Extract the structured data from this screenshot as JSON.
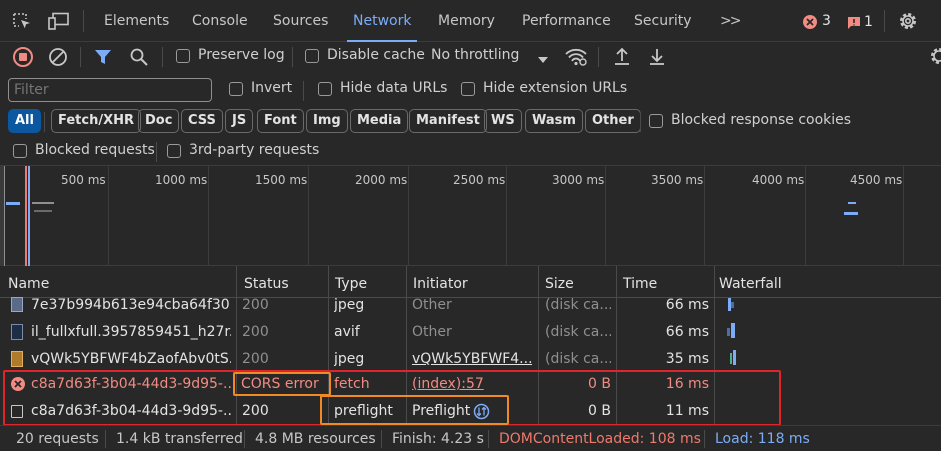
{
  "tabs": [
    {
      "label": "Elements"
    },
    {
      "label": "Console"
    },
    {
      "label": "Sources"
    },
    {
      "label": "Network"
    },
    {
      "label": "Memory"
    },
    {
      "label": "Performance"
    },
    {
      "label": "Security"
    }
  ],
  "more_tabs": ">>",
  "error_count": "3",
  "issue_count": "1",
  "toolbar": {
    "preserve_log": "Preserve log",
    "disable_cache": "Disable cache",
    "throttling": "No throttling"
  },
  "filter": {
    "placeholder": "Filter",
    "invert": "Invert",
    "hide_data_urls": "Hide data URLs",
    "hide_extension_urls": "Hide extension URLs"
  },
  "type_filters": [
    "All",
    "Fetch/XHR",
    "Doc",
    "CSS",
    "JS",
    "Font",
    "Img",
    "Media",
    "Manifest",
    "WS",
    "Wasm",
    "Other"
  ],
  "blocked_response_cookies": "Blocked response cookies",
  "blocked_requests": "Blocked requests",
  "third_party_requests": "3rd-party requests",
  "overview_ticks": [
    "500 ms",
    "1000 ms",
    "1500 ms",
    "2000 ms",
    "2500 ms",
    "3000 ms",
    "3500 ms",
    "4000 ms",
    "4500 ms"
  ],
  "columns": {
    "name": "Name",
    "status": "Status",
    "type": "Type",
    "initiator": "Initiator",
    "size": "Size",
    "time": "Time",
    "waterfall": "Waterfall"
  },
  "rows": [
    {
      "name": "7e37b994b613e94cba64f30...",
      "status": "200",
      "type": "jpeg",
      "initiator": "Other",
      "size": "(disk ca...",
      "time": "66 ms"
    },
    {
      "name": "il_fullxfull.3957859451_h27r.j...",
      "status": "200",
      "type": "avif",
      "initiator": "Other",
      "size": "(disk ca...",
      "time": "66 ms"
    },
    {
      "name": "vQWk5YBFWF4bZaofAbv0tS...",
      "status": "200",
      "type": "jpeg",
      "initiator": "vQWk5YBFWF4...",
      "size": "(disk ca...",
      "time": "35 ms"
    },
    {
      "name": "c8a7d63f-3b04-44d3-9d95-...",
      "status": "CORS error",
      "type": "fetch",
      "initiator": "(index):57",
      "size": "0 B",
      "time": "16 ms"
    },
    {
      "name": "c8a7d63f-3b04-44d3-9d95-...",
      "status": "200",
      "type": "preflight",
      "initiator": "Preflight",
      "size": "0 B",
      "time": "11 ms"
    }
  ],
  "status": {
    "requests": "20 requests",
    "transferred": "1.4 kB transferred",
    "resources": "4.8 MB resources",
    "finish": "Finish: 4.23 s",
    "dom_content_loaded": "DOMContentLoaded: 108 ms",
    "load": "Load: 118 ms"
  },
  "colors": {
    "accent": "#7cacf8",
    "error": "#f28b82",
    "annotation_red": "#e0242b",
    "annotation_orange": "#f08a24",
    "dcl": "#ee7a6c",
    "load": "#7cacf8"
  }
}
